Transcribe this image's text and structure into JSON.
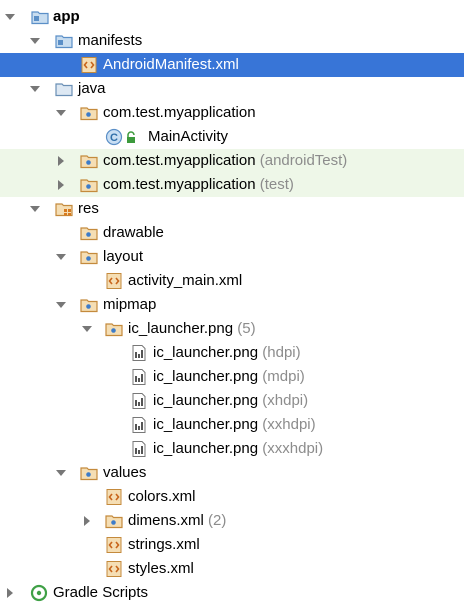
{
  "tree": {
    "app": {
      "label": "app"
    },
    "manifests": {
      "label": "manifests"
    },
    "android_manifest": {
      "label": "AndroidManifest.xml"
    },
    "java": {
      "label": "java"
    },
    "pkg_main": {
      "label": "com.test.myapplication"
    },
    "main_activity": {
      "label": "MainActivity"
    },
    "pkg_android_test": {
      "label": "com.test.myapplication",
      "suffix": "(androidTest)"
    },
    "pkg_test": {
      "label": "com.test.myapplication",
      "suffix": "(test)"
    },
    "res": {
      "label": "res"
    },
    "drawable": {
      "label": "drawable"
    },
    "layout": {
      "label": "layout"
    },
    "activity_main": {
      "label": "activity_main.xml"
    },
    "mipmap": {
      "label": "mipmap"
    },
    "ic_launcher_group": {
      "label": "ic_launcher.png",
      "suffix": "(5)"
    },
    "ic_hdpi": {
      "label": "ic_launcher.png",
      "suffix": "(hdpi)"
    },
    "ic_mdpi": {
      "label": "ic_launcher.png",
      "suffix": "(mdpi)"
    },
    "ic_xhdpi": {
      "label": "ic_launcher.png",
      "suffix": "(xhdpi)"
    },
    "ic_xxhdpi": {
      "label": "ic_launcher.png",
      "suffix": "(xxhdpi)"
    },
    "ic_xxxhdpi": {
      "label": "ic_launcher.png",
      "suffix": "(xxxhdpi)"
    },
    "values": {
      "label": "values"
    },
    "colors": {
      "label": "colors.xml"
    },
    "dimens": {
      "label": "dimens.xml",
      "suffix": "(2)"
    },
    "strings": {
      "label": "strings.xml"
    },
    "styles": {
      "label": "styles.xml"
    },
    "gradle_scripts": {
      "label": "Gradle Scripts"
    }
  },
  "colors": {
    "selection": "#3875d7",
    "test_source_background": "#eef7e8",
    "suffix_text": "#8c8c8c",
    "folder_blue": "#6aa0d6",
    "package_orange": "#d49a4a",
    "xml_orange": "#e8a33d",
    "class_icon": "#5fa0d8",
    "gradle_green": "#4caf50"
  }
}
